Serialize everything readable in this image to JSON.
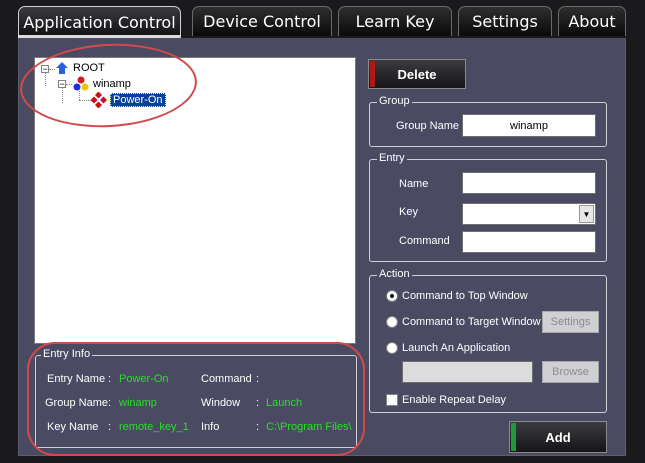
{
  "tabs": [
    {
      "label": "Application Control",
      "active": true
    },
    {
      "label": "Device Control",
      "active": false
    },
    {
      "label": "Learn Key",
      "active": false
    },
    {
      "label": "Settings",
      "active": false
    },
    {
      "label": "About",
      "active": false
    }
  ],
  "tree": {
    "root": "ROOT",
    "group": "winamp",
    "entry": "Power-On"
  },
  "buttons": {
    "delete": "Delete",
    "add": "Add",
    "settings": "Settings",
    "browse": "Browse"
  },
  "group_box": {
    "title": "Group",
    "name_label": "Group Name",
    "name_value": "winamp"
  },
  "entry_box": {
    "title": "Entry",
    "name_label": "Name",
    "name_value": "",
    "key_label": "Key",
    "key_value": "",
    "command_label": "Command",
    "command_value": ""
  },
  "action_box": {
    "title": "Action",
    "options": [
      {
        "label": "Command to Top Window",
        "checked": true
      },
      {
        "label": "Command to Target Window",
        "checked": false
      },
      {
        "label": "Launch An Application",
        "checked": false
      }
    ],
    "app_path": "",
    "repeat_label": "Enable Repeat Delay",
    "repeat_checked": false
  },
  "entry_info": {
    "title": "Entry Info",
    "entry_name_label": "Entry Name",
    "entry_name_value": "Power-On",
    "group_name_label": "Group Name",
    "group_name_value": "winamp",
    "key_name_label": "Key Name",
    "key_name_value": "remote_key_1",
    "command_label": "Command",
    "command_value": "",
    "window_label": "Window",
    "window_value": "Launch",
    "info_label": "Info",
    "info_value": "C:\\Program Files\\",
    "separator": ":"
  },
  "colors": {
    "panel": "#4a4a62",
    "info_value": "#27e027",
    "delete_accent": "#b01818",
    "add_accent": "#1f9a3a",
    "annotation": "#d34a4a",
    "selection": "#0a3f9c"
  }
}
